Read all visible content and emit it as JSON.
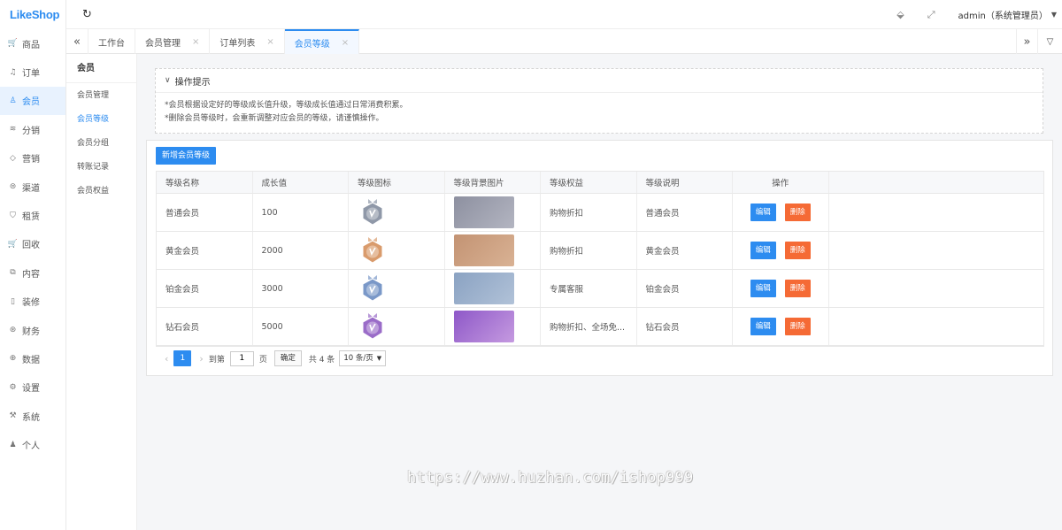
{
  "app": {
    "logo": "LikeShop"
  },
  "sidebar": {
    "items": [
      {
        "label": "商品",
        "icon": "cart-icon",
        "glyph": "🛒"
      },
      {
        "label": "订单",
        "icon": "bell-icon",
        "glyph": "♫"
      },
      {
        "label": "会员",
        "icon": "user-icon",
        "glyph": "♙"
      },
      {
        "label": "分销",
        "icon": "layers-icon",
        "glyph": "≋"
      },
      {
        "label": "营销",
        "icon": "diamond-icon",
        "glyph": "◇"
      },
      {
        "label": "渠道",
        "icon": "coin-icon",
        "glyph": "⊜"
      },
      {
        "label": "租赁",
        "icon": "shield-icon",
        "glyph": "⛉"
      },
      {
        "label": "回收",
        "icon": "cart-icon",
        "glyph": "🛒"
      },
      {
        "label": "内容",
        "icon": "book-icon",
        "glyph": "⧉"
      },
      {
        "label": "装修",
        "icon": "phone-icon",
        "glyph": "▯"
      },
      {
        "label": "财务",
        "icon": "finance-icon",
        "glyph": "⊛"
      },
      {
        "label": "数据",
        "icon": "globe-icon",
        "glyph": "⊕"
      },
      {
        "label": "设置",
        "icon": "gear-icon",
        "glyph": "⚙"
      },
      {
        "label": "系统",
        "icon": "tool-icon",
        "glyph": "⚒"
      },
      {
        "label": "个人",
        "icon": "person-icon",
        "glyph": "♟"
      }
    ],
    "active_index": 2
  },
  "topbar": {
    "user": "admin（系统管理员）"
  },
  "tabs": [
    {
      "label": "工作台",
      "closable": false
    },
    {
      "label": "会员管理",
      "closable": true
    },
    {
      "label": "订单列表",
      "closable": true
    },
    {
      "label": "会员等级",
      "closable": true
    }
  ],
  "subsidebar": {
    "title": "会员",
    "items": [
      "会员管理",
      "会员等级",
      "会员分组",
      "转账记录",
      "会员权益"
    ],
    "active_index": 1
  },
  "tips": {
    "title": "操作提示",
    "lines": [
      "*会员根据设定好的等级成长值升级，等级成长值通过日常消费积累。",
      "*删除会员等级时，会重新调整对应会员的等级，请谨慎操作。"
    ]
  },
  "toolbar": {
    "add_label": "新增会员等级"
  },
  "table": {
    "headers": [
      "等级名称",
      "成长值",
      "等级图标",
      "等级背景图片",
      "等级权益",
      "等级说明",
      "操作"
    ],
    "edit_label": "编辑",
    "delete_label": "删除",
    "rows": [
      {
        "name": "普通会员",
        "growth": "100",
        "badge_color": "#8f98a8",
        "bg_from": "#8d90a0",
        "bg_to": "#b3b5c1",
        "rights": "购物折扣",
        "desc": "普通会员"
      },
      {
        "name": "黄金会员",
        "growth": "2000",
        "badge_color": "#d99b6c",
        "bg_from": "#c39373",
        "bg_to": "#d9b294",
        "rights": "购物折扣",
        "desc": "黄金会员"
      },
      {
        "name": "铂金会员",
        "growth": "3000",
        "badge_color": "#7a98c8",
        "bg_from": "#8aa2c2",
        "bg_to": "#b1c2d8",
        "rights": "专属客服",
        "desc": "铂金会员"
      },
      {
        "name": "钻石会员",
        "growth": "5000",
        "badge_color": "#9a6cc8",
        "bg_from": "#8e58c8",
        "bg_to": "#c59ae0",
        "rights": "购物折扣、全场免...",
        "desc": "钻石会员"
      }
    ]
  },
  "pager": {
    "current": "1",
    "goto_label": "到第",
    "goto_value": "1",
    "page_unit": "页",
    "confirm_label": "确定",
    "total_label": "共 4 条",
    "page_size": "10 条/页"
  },
  "watermark": "https://www.huzhan.com/ishop999"
}
